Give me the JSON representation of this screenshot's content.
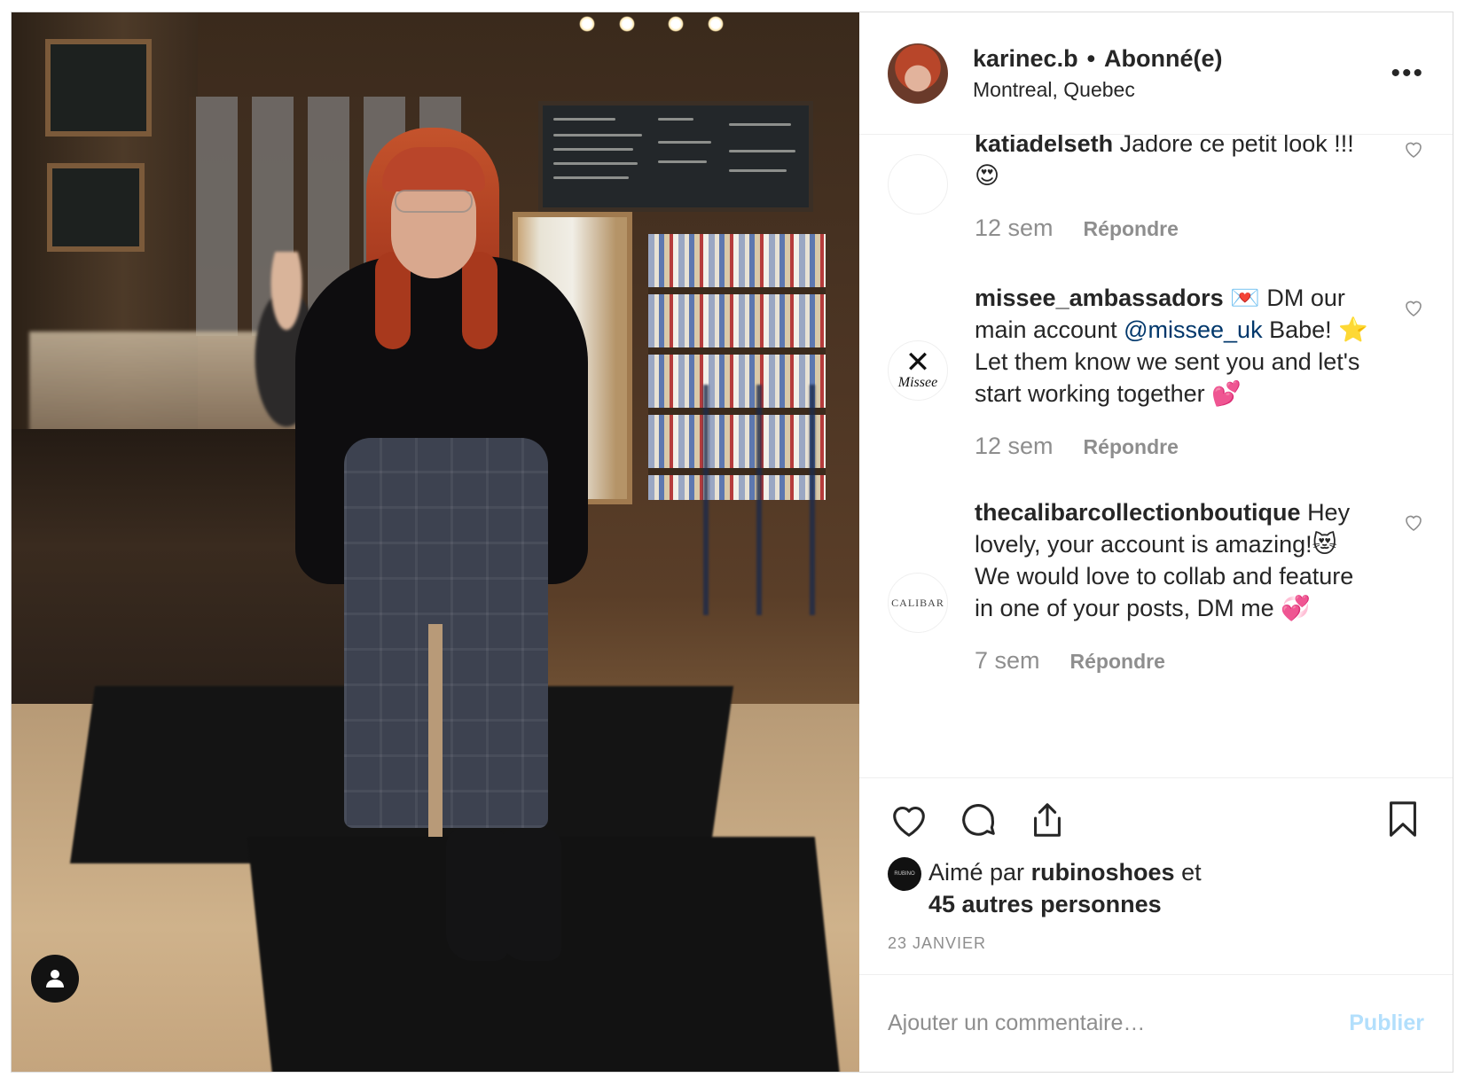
{
  "post": {
    "username": "karinec.b",
    "separator": "•",
    "follow_status": "Abonné(e)",
    "location": "Montreal, Quebec",
    "more_label": "•••"
  },
  "comments": [
    {
      "username": "katiadelseth",
      "text": "Jadore ce petit look !!!😍",
      "time": "12 sem",
      "reply_label": "Répondre"
    },
    {
      "username": "missee_ambassadors",
      "text_before": "💌  DM our main account",
      "mention": "@missee_uk",
      "text_after": "Babe! ⭐ Let them know we sent you and let's start working together 💕",
      "time": "12 sem",
      "reply_label": "Répondre",
      "avatar_text": "Missee",
      "avatar_symbol": "✕"
    },
    {
      "username": "thecalibarcollectionboutique",
      "text": "Hey lovely, your account is amazing!😻 We would love to collab and feature in one of your posts, DM me 💞",
      "time": "7 sem",
      "reply_label": "Répondre",
      "avatar_text": "CALIBAR"
    }
  ],
  "likes": {
    "prefix": "Aimé par",
    "liker": "rubinoshoes",
    "conjunction": "et",
    "others": "45 autres personnes",
    "mini_avatar_text": "RUBINO"
  },
  "date": "23 JANVIER",
  "comment_box": {
    "placeholder": "Ajouter un commentaire…",
    "publish_label": "Publier"
  },
  "icons": {
    "like": "heart-icon",
    "comment": "comment-icon",
    "share": "share-icon",
    "save": "bookmark-icon",
    "user_tags": "user-icon"
  },
  "colors": {
    "text": "#262626",
    "secondary": "#8e8e8e",
    "link": "#00376b",
    "publish_disabled": "#b2dffc",
    "border": "#dbdbdb"
  }
}
